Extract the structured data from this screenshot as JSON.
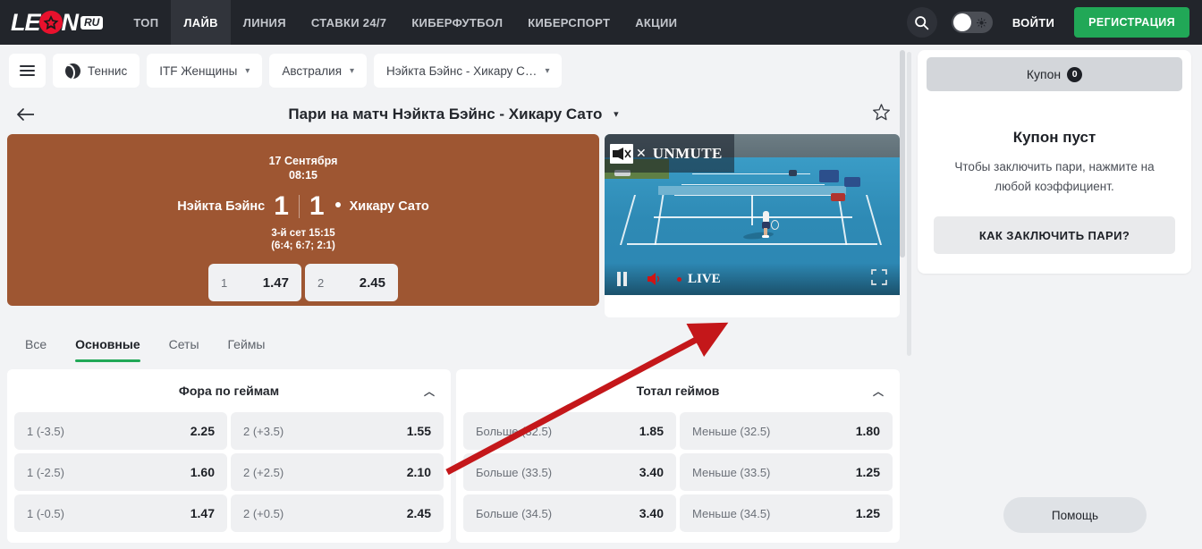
{
  "header": {
    "logo": {
      "text_before": "LE",
      "text_after": "N",
      "badge": "RU",
      "icon": "star-ball-logo"
    },
    "nav": [
      {
        "label": "ТОП",
        "active": false
      },
      {
        "label": "ЛАЙВ",
        "active": true
      },
      {
        "label": "ЛИНИЯ",
        "active": false
      },
      {
        "label": "СТАВКИ 24/7",
        "active": false
      },
      {
        "label": "КИБЕРФУТБОЛ",
        "active": false
      },
      {
        "label": "КИБЕРСПОРТ",
        "active": false
      },
      {
        "label": "АКЦИИ",
        "active": false
      }
    ],
    "search_icon": "search-icon",
    "theme_toggle_icon": "sun-icon",
    "login_label": "ВОЙТИ",
    "register_label": "РЕГИСТРАЦИЯ",
    "colors": {
      "bar": "#22252b",
      "active_tab": "#31343b",
      "register": "#21a857"
    }
  },
  "filterbar": {
    "menu_icon": "hamburger-icon",
    "sport": {
      "label": "Теннис",
      "icon": "tennis-ball-icon"
    },
    "league": {
      "label": "ITF Женщины",
      "caret": "chevron-down-icon"
    },
    "country": {
      "label": "Австралия",
      "caret": "chevron-down-icon"
    },
    "match": {
      "label": "Нэйкта Бэйнс - Хикару С…",
      "caret": "chevron-down-icon"
    }
  },
  "title": {
    "back_icon": "back-arrow-icon",
    "text": "Пари на матч Нэйкта Бэйнс - Хикару Сато",
    "caret": "chevron-down-icon",
    "favorite_icon": "star-outline-icon"
  },
  "scoreboard": {
    "date": "17 Сентября",
    "time": "08:15",
    "home_team": "Нэйкта Бэйнс",
    "away_team": "Хикару Сато",
    "home_score": "1",
    "away_score": "1",
    "server": "away",
    "set_info": "3-й сет 15:15",
    "sets_detail": "(6:4; 6:7; 2:1)",
    "odds": [
      {
        "label": "1",
        "value": "1.47"
      },
      {
        "label": "2",
        "value": "2.45"
      }
    ],
    "color": "#9e5632"
  },
  "video": {
    "unmute_label": "UNMUTE",
    "unmute_close_icon": "close-icon",
    "mute_icon": "muted-speaker-icon",
    "pause_icon": "pause-icon",
    "volume_icon": "volume-icon",
    "live_label": "LIVE",
    "fullscreen_icon": "fullscreen-icon"
  },
  "tabs": [
    {
      "label": "Все",
      "active": false
    },
    {
      "label": "Основные",
      "active": true
    },
    {
      "label": "Сеты",
      "active": false
    },
    {
      "label": "Геймы",
      "active": false
    }
  ],
  "markets": [
    {
      "title": "Фора по геймам",
      "collapse_icon": "chevron-up-icon",
      "rows": [
        [
          {
            "label": "1 (-3.5)",
            "value": "2.25"
          },
          {
            "label": "2 (+3.5)",
            "value": "1.55"
          }
        ],
        [
          {
            "label": "1 (-2.5)",
            "value": "1.60"
          },
          {
            "label": "2 (+2.5)",
            "value": "2.10"
          }
        ],
        [
          {
            "label": "1 (-0.5)",
            "value": "1.47"
          },
          {
            "label": "2 (+0.5)",
            "value": "2.45"
          }
        ]
      ]
    },
    {
      "title": "Тотал геймов",
      "collapse_icon": "chevron-up-icon",
      "rows": [
        [
          {
            "label": "Больше (32.5)",
            "value": "1.85"
          },
          {
            "label": "Меньше (32.5)",
            "value": "1.80"
          }
        ],
        [
          {
            "label": "Больше (33.5)",
            "value": "3.40"
          },
          {
            "label": "Меньше (33.5)",
            "value": "1.25"
          }
        ],
        [
          {
            "label": "Больше (34.5)",
            "value": "3.40"
          },
          {
            "label": "Меньше (34.5)",
            "value": "1.25"
          }
        ]
      ]
    }
  ],
  "sidebar": {
    "coupon_tab_label": "Купон",
    "coupon_count": "0",
    "empty_title": "Купон пуст",
    "empty_text": "Чтобы заключить пари, нажмите на любой коэффициент.",
    "how_button": "КАК ЗАКЛЮЧИТЬ ПАРИ?",
    "help_button": "Помощь"
  },
  "annotation": {
    "arrow_color": "#c4171a"
  }
}
